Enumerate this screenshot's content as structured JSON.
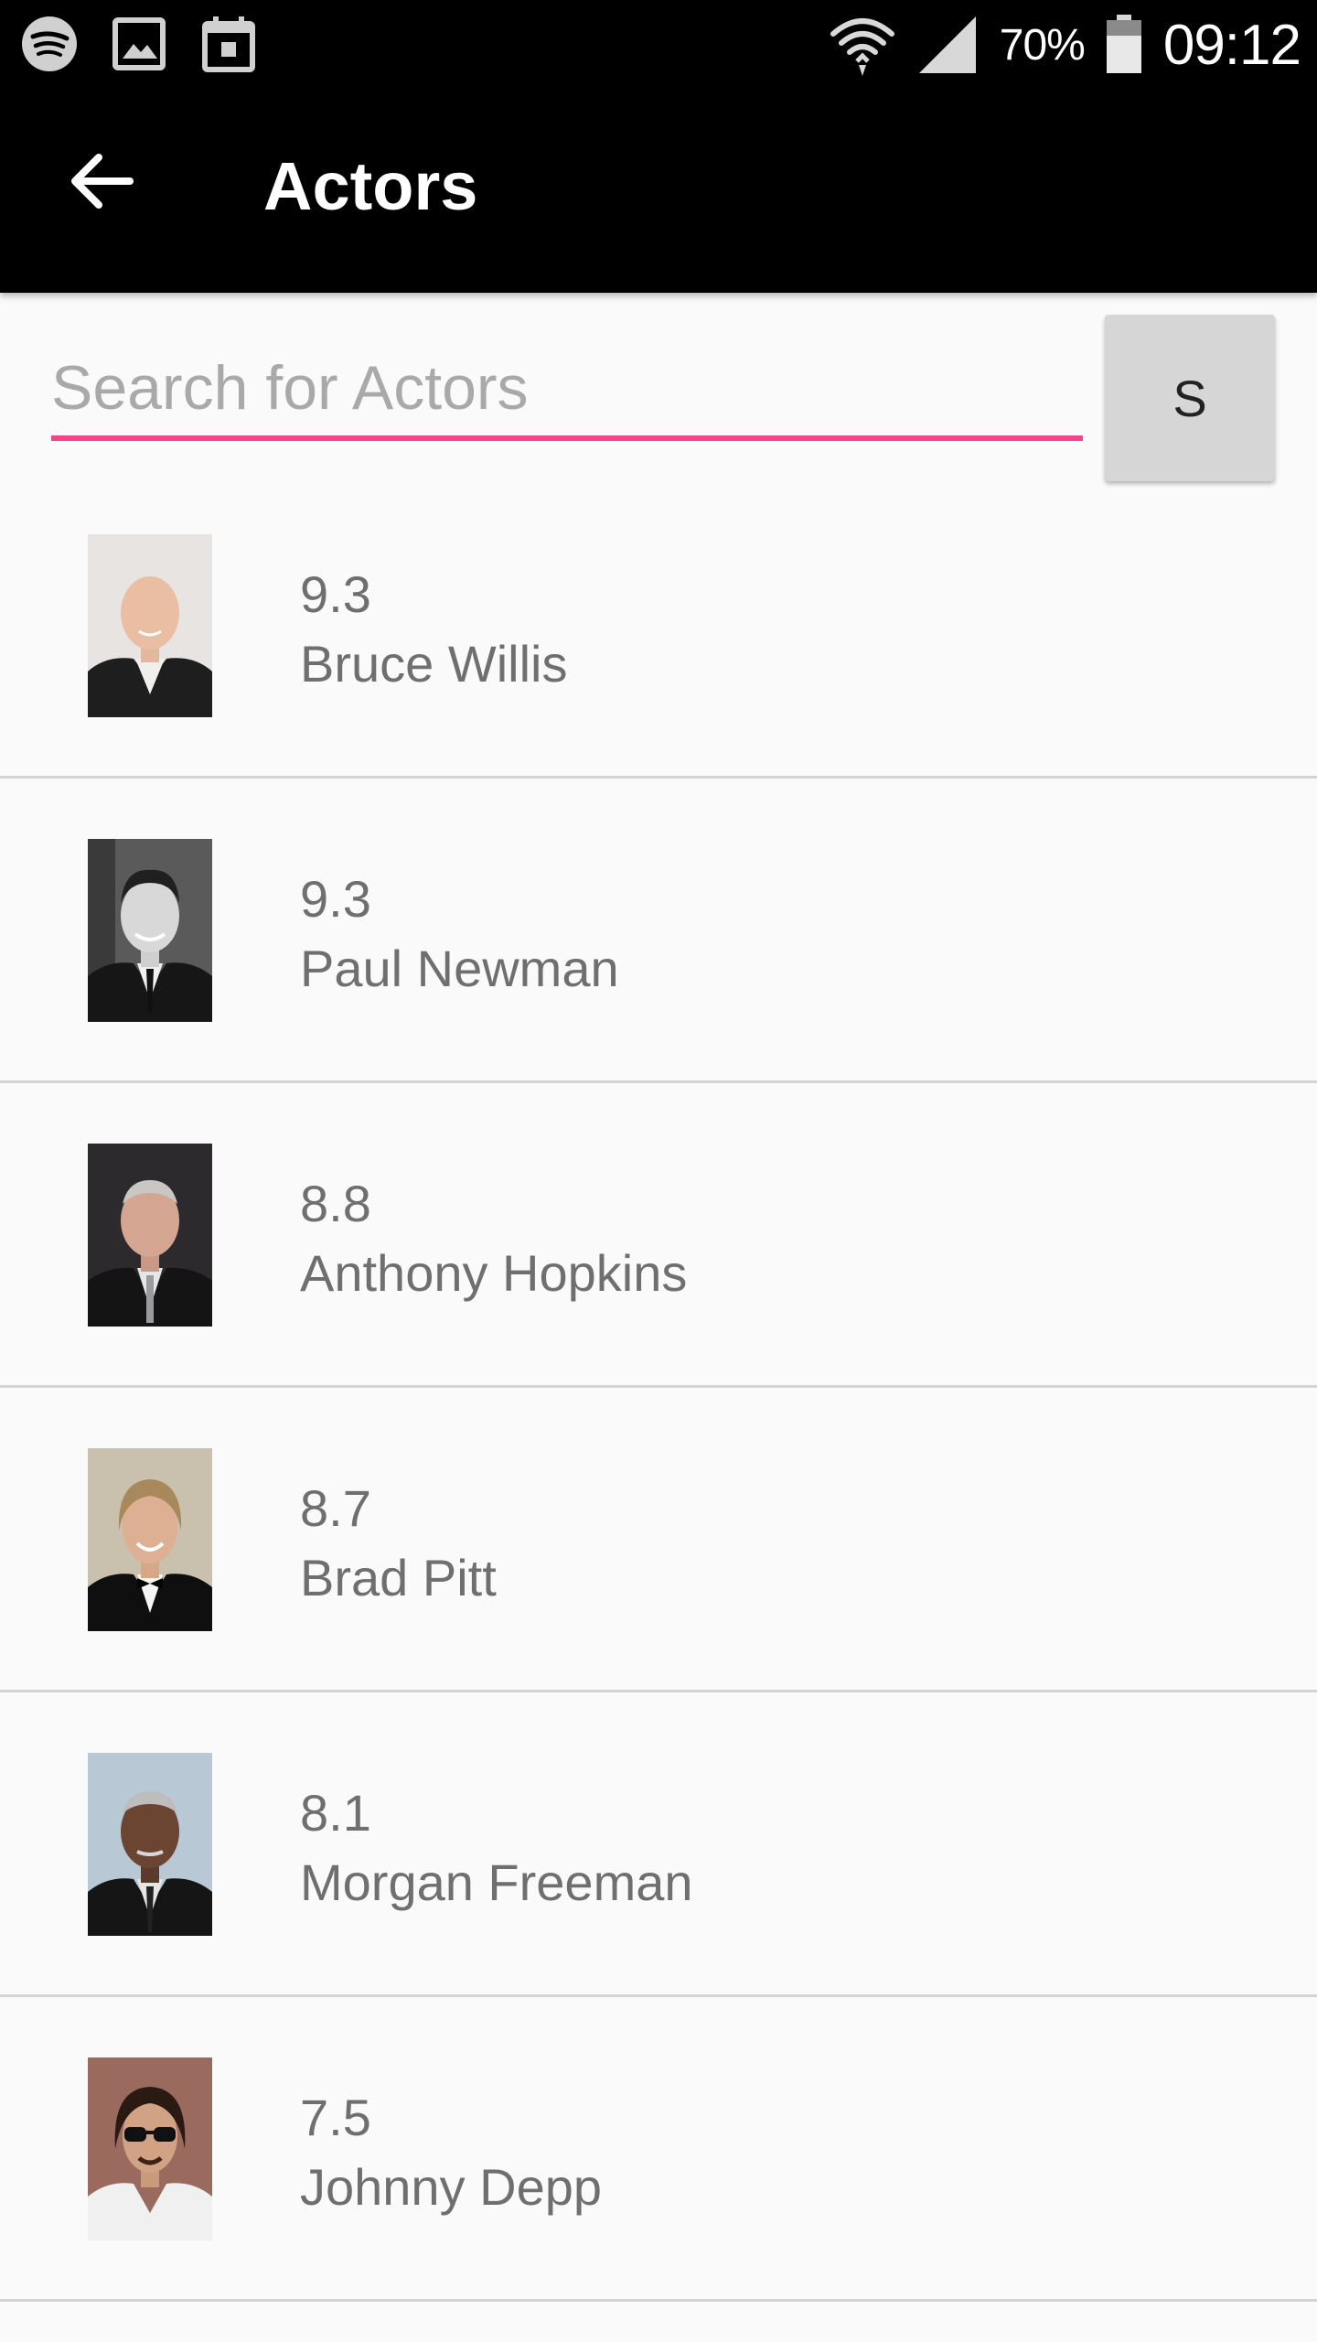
{
  "status_bar": {
    "left_icons": [
      "spotify-icon",
      "gallery-icon",
      "calendar-icon"
    ],
    "right_icons": [
      "wifi-icon",
      "signal-icon",
      "battery-icon"
    ],
    "battery_percent": "70%",
    "time": "09:12"
  },
  "app_bar": {
    "back_icon": "arrow-back-icon",
    "title": "Actors"
  },
  "search": {
    "placeholder": "Search for Actors",
    "value": "",
    "button_label": "S",
    "accent_color": "#f1468a"
  },
  "actors": [
    {
      "rating": "9.3",
      "name": "Bruce Willis"
    },
    {
      "rating": "9.3",
      "name": "Paul Newman"
    },
    {
      "rating": "8.8",
      "name": "Anthony Hopkins"
    },
    {
      "rating": "8.7",
      "name": "Brad Pitt"
    },
    {
      "rating": "8.1",
      "name": "Morgan Freeman"
    },
    {
      "rating": "7.5",
      "name": "Johnny Depp"
    }
  ]
}
